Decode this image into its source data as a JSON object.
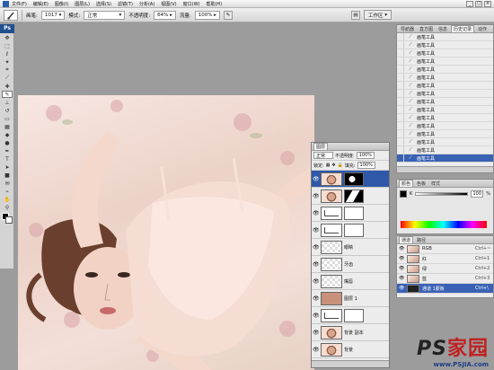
{
  "menubar": {
    "items": [
      "文件(F)",
      "编辑(E)",
      "图像(I)",
      "图层(L)",
      "选择(S)",
      "滤镜(T)",
      "分析(A)",
      "视图(V)",
      "窗口(W)",
      "帮助(H)"
    ],
    "win_buttons": [
      "_",
      "□",
      "×"
    ]
  },
  "options_bar": {
    "brush_label": "画笔:",
    "brush_size": "1017",
    "mode_label": "模式:",
    "mode_value": "正常",
    "opacity_label": "不透明度:",
    "opacity_value": "64%",
    "flow_label": "流量:",
    "flow_value": "100%",
    "workspace_label": "工作区"
  },
  "toolbox": {
    "badge": "Ps",
    "tools": [
      "move-icon",
      "marquee-icon",
      "lasso-icon",
      "magic-wand-icon",
      "crop-icon",
      "slice-icon",
      "healing-icon",
      "brush-icon",
      "stamp-icon",
      "history-brush-icon",
      "eraser-icon",
      "gradient-icon",
      "blur-icon",
      "dodge-icon",
      "pen-icon",
      "type-icon",
      "path-select-icon",
      "shape-icon",
      "notes-icon",
      "eyedropper-icon",
      "hand-icon",
      "zoom-icon"
    ]
  },
  "history_panel": {
    "tabs": [
      "导航器",
      "直方图",
      "信息",
      "历史记录",
      "动作"
    ],
    "active_tab": "历史记录",
    "items": [
      "画笔工具",
      "画笔工具",
      "画笔工具",
      "画笔工具",
      "画笔工具",
      "画笔工具",
      "画笔工具",
      "画笔工具",
      "画笔工具",
      "画笔工具",
      "画笔工具",
      "画笔工具",
      "画笔工具",
      "画笔工具",
      "画笔工具",
      "画笔工具"
    ],
    "selected_index": 15
  },
  "color_panel": {
    "tabs": [
      "颜色",
      "色板",
      "样式"
    ],
    "active_tab": "颜色",
    "channel_label": "K",
    "channel_value": "100",
    "channel_unit": "%"
  },
  "channels_panel": {
    "tabs": [
      "通道",
      "路径"
    ],
    "active_tab": "通道",
    "rows": [
      {
        "name": "RGB",
        "shortcut": "Ctrl+~",
        "selected": false
      },
      {
        "name": "红",
        "shortcut": "Ctrl+1",
        "selected": false
      },
      {
        "name": "绿",
        "shortcut": "Ctrl+2",
        "selected": false
      },
      {
        "name": "蓝",
        "shortcut": "Ctrl+3",
        "selected": false
      },
      {
        "name": "通道 1蒙板",
        "shortcut": "Ctrl+\\",
        "selected": true
      }
    ]
  },
  "layers_panel": {
    "tabs": [
      "图层"
    ],
    "blend_mode": "正常",
    "opacity_label": "不透明度:",
    "opacity_value": "100%",
    "lock_label": "锁定:",
    "fill_label": "填充:",
    "fill_value": "100%",
    "layers": [
      {
        "name": "",
        "thumb": "photo",
        "mask": "dark",
        "selected": true
      },
      {
        "name": "",
        "thumb": "photo",
        "mask": "mix",
        "selected": false
      },
      {
        "name": "",
        "thumb": "curve",
        "mask": "white",
        "selected": false
      },
      {
        "name": "",
        "thumb": "curve",
        "mask": "white",
        "selected": false
      },
      {
        "name": "眼睛",
        "thumb": "check",
        "mask": "",
        "selected": false
      },
      {
        "name": "牙齿",
        "thumb": "check",
        "mask": "",
        "selected": false
      },
      {
        "name": "嘴唇",
        "thumb": "check",
        "mask": "",
        "selected": false
      },
      {
        "name": "图层 1",
        "thumb": "skin",
        "mask": "",
        "selected": false
      },
      {
        "name": "",
        "thumb": "curve",
        "mask": "white",
        "selected": false
      },
      {
        "name": "背景 副本",
        "thumb": "photo",
        "mask": "",
        "selected": false
      },
      {
        "name": "背景",
        "thumb": "photo",
        "mask": "",
        "selected": false
      }
    ]
  },
  "watermark": {
    "brand_latin": "PS",
    "brand_cn": "家园",
    "url": "www.PSJIA.com"
  }
}
